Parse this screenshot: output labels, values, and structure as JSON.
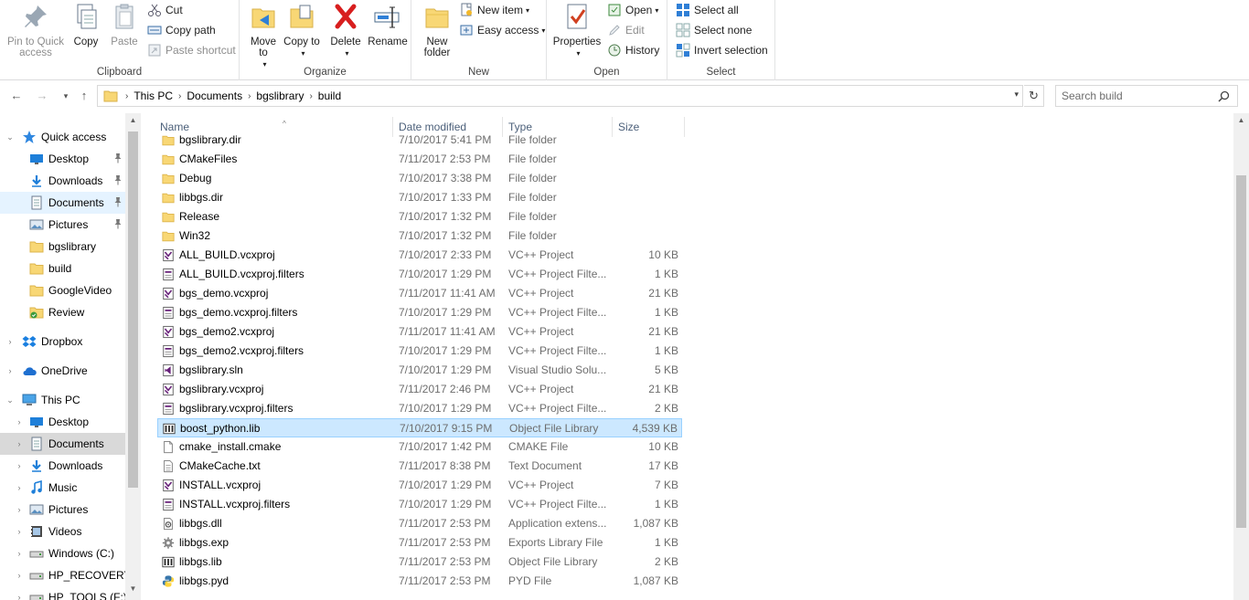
{
  "ribbon": {
    "clipboard": {
      "label": "Clipboard",
      "pin": "Pin to Quick access",
      "copy": "Copy",
      "paste": "Paste",
      "cut": "Cut",
      "copy_path": "Copy path",
      "paste_shortcut": "Paste shortcut"
    },
    "organize": {
      "label": "Organize",
      "move_to": "Move to",
      "copy_to": "Copy to",
      "delete": "Delete",
      "rename": "Rename"
    },
    "new": {
      "label": "New",
      "new_folder": "New folder",
      "new_item": "New item",
      "easy_access": "Easy access"
    },
    "open": {
      "label": "Open",
      "properties": "Properties",
      "open": "Open",
      "edit": "Edit",
      "history": "History"
    },
    "select": {
      "label": "Select",
      "select_all": "Select all",
      "select_none": "Select none",
      "invert": "Invert selection"
    }
  },
  "address": {
    "crumbs": [
      "This PC",
      "Documents",
      "bgslibrary",
      "build"
    ],
    "search_placeholder": "Search build"
  },
  "nav": [
    {
      "label": "Quick access",
      "icon": "star-icon",
      "level": 0,
      "expanded": true
    },
    {
      "label": "Desktop",
      "icon": "desktop-icon",
      "level": 1,
      "pinned": true
    },
    {
      "label": "Downloads",
      "icon": "download-icon",
      "level": 1,
      "pinned": true
    },
    {
      "label": "Documents",
      "icon": "document-icon",
      "level": 1,
      "pinned": true,
      "selected": true
    },
    {
      "label": "Pictures",
      "icon": "pictures-icon",
      "level": 1,
      "pinned": true
    },
    {
      "label": "bgslibrary",
      "icon": "folder-icon",
      "level": 1
    },
    {
      "label": "build",
      "icon": "folder-icon",
      "level": 1
    },
    {
      "label": "GoogleVideo",
      "icon": "folder-icon",
      "level": 1
    },
    {
      "label": "Review",
      "icon": "folder-check-icon",
      "level": 1
    },
    {
      "label": "Dropbox",
      "icon": "dropbox-icon",
      "level": 0,
      "expanded": false
    },
    {
      "label": "OneDrive",
      "icon": "cloud-icon",
      "level": 0,
      "expanded": false
    },
    {
      "label": "This PC",
      "icon": "computer-icon",
      "level": 0,
      "expanded": true
    },
    {
      "label": "Desktop",
      "icon": "desktop-icon",
      "level": 1,
      "expandable": true
    },
    {
      "label": "Documents",
      "icon": "document-icon",
      "level": 1,
      "expandable": true,
      "current": true
    },
    {
      "label": "Downloads",
      "icon": "download-icon",
      "level": 1,
      "expandable": true
    },
    {
      "label": "Music",
      "icon": "music-icon",
      "level": 1,
      "expandable": true
    },
    {
      "label": "Pictures",
      "icon": "pictures-icon",
      "level": 1,
      "expandable": true
    },
    {
      "label": "Videos",
      "icon": "videos-icon",
      "level": 1,
      "expandable": true
    },
    {
      "label": "Windows (C:)",
      "icon": "drive-icon",
      "level": 1,
      "expandable": true
    },
    {
      "label": "HP_RECOVERY (",
      "icon": "drive-icon",
      "level": 1,
      "expandable": true
    },
    {
      "label": "HP_TOOLS (F:)",
      "icon": "drive-icon",
      "level": 1,
      "expandable": true
    }
  ],
  "columns": {
    "name": "Name",
    "date": "Date modified",
    "type": "Type",
    "size": "Size"
  },
  "files": [
    {
      "name": "bgslibrary.dir",
      "date": "7/10/2017 5:41 PM",
      "type": "File folder",
      "size": "",
      "icon": "folder-icon"
    },
    {
      "name": "CMakeFiles",
      "date": "7/11/2017 2:53 PM",
      "type": "File folder",
      "size": "",
      "icon": "folder-icon"
    },
    {
      "name": "Debug",
      "date": "7/10/2017 3:38 PM",
      "type": "File folder",
      "size": "",
      "icon": "folder-icon"
    },
    {
      "name": "libbgs.dir",
      "date": "7/10/2017 1:33 PM",
      "type": "File folder",
      "size": "",
      "icon": "folder-icon"
    },
    {
      "name": "Release",
      "date": "7/10/2017 1:32 PM",
      "type": "File folder",
      "size": "",
      "icon": "folder-icon"
    },
    {
      "name": "Win32",
      "date": "7/10/2017 1:32 PM",
      "type": "File folder",
      "size": "",
      "icon": "folder-icon"
    },
    {
      "name": "ALL_BUILD.vcxproj",
      "date": "7/10/2017 2:33 PM",
      "type": "VC++ Project",
      "size": "10 KB",
      "icon": "vcxproj-icon"
    },
    {
      "name": "ALL_BUILD.vcxproj.filters",
      "date": "7/10/2017 1:29 PM",
      "type": "VC++ Project Filte...",
      "size": "1 KB",
      "icon": "filters-icon"
    },
    {
      "name": "bgs_demo.vcxproj",
      "date": "7/11/2017 11:41 AM",
      "type": "VC++ Project",
      "size": "21 KB",
      "icon": "vcxproj-icon"
    },
    {
      "name": "bgs_demo.vcxproj.filters",
      "date": "7/10/2017 1:29 PM",
      "type": "VC++ Project Filte...",
      "size": "1 KB",
      "icon": "filters-icon"
    },
    {
      "name": "bgs_demo2.vcxproj",
      "date": "7/11/2017 11:41 AM",
      "type": "VC++ Project",
      "size": "21 KB",
      "icon": "vcxproj-icon"
    },
    {
      "name": "bgs_demo2.vcxproj.filters",
      "date": "7/10/2017 1:29 PM",
      "type": "VC++ Project Filte...",
      "size": "1 KB",
      "icon": "filters-icon"
    },
    {
      "name": "bgslibrary.sln",
      "date": "7/10/2017 1:29 PM",
      "type": "Visual Studio Solu...",
      "size": "5 KB",
      "icon": "sln-icon"
    },
    {
      "name": "bgslibrary.vcxproj",
      "date": "7/11/2017 2:46 PM",
      "type": "VC++ Project",
      "size": "21 KB",
      "icon": "vcxproj-icon"
    },
    {
      "name": "bgslibrary.vcxproj.filters",
      "date": "7/10/2017 1:29 PM",
      "type": "VC++ Project Filte...",
      "size": "2 KB",
      "icon": "filters-icon"
    },
    {
      "name": "boost_python.lib",
      "date": "7/10/2017 9:15 PM",
      "type": "Object File Library",
      "size": "4,539 KB",
      "icon": "lib-icon",
      "selected": true
    },
    {
      "name": "cmake_install.cmake",
      "date": "7/10/2017 1:42 PM",
      "type": "CMAKE File",
      "size": "10 KB",
      "icon": "blank-file-icon"
    },
    {
      "name": "CMakeCache.txt",
      "date": "7/11/2017 8:38 PM",
      "type": "Text Document",
      "size": "17 KB",
      "icon": "text-file-icon"
    },
    {
      "name": "INSTALL.vcxproj",
      "date": "7/10/2017 1:29 PM",
      "type": "VC++ Project",
      "size": "7 KB",
      "icon": "vcxproj-icon"
    },
    {
      "name": "INSTALL.vcxproj.filters",
      "date": "7/10/2017 1:29 PM",
      "type": "VC++ Project Filte...",
      "size": "1 KB",
      "icon": "filters-icon"
    },
    {
      "name": "libbgs.dll",
      "date": "7/11/2017 2:53 PM",
      "type": "Application extens...",
      "size": "1,087 KB",
      "icon": "dll-icon"
    },
    {
      "name": "libbgs.exp",
      "date": "7/11/2017 2:53 PM",
      "type": "Exports Library File",
      "size": "1 KB",
      "icon": "exp-icon"
    },
    {
      "name": "libbgs.lib",
      "date": "7/11/2017 2:53 PM",
      "type": "Object File Library",
      "size": "2 KB",
      "icon": "lib-icon"
    },
    {
      "name": "libbgs.pyd",
      "date": "7/11/2017 2:53 PM",
      "type": "PYD File",
      "size": "1,087 KB",
      "icon": "python-icon"
    }
  ]
}
